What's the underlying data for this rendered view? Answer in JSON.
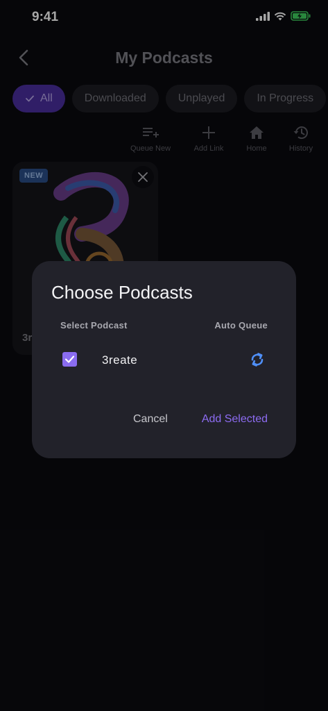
{
  "status": {
    "time": "9:41"
  },
  "nav": {
    "title": "My Podcasts"
  },
  "filters": [
    {
      "label": "All",
      "active": true
    },
    {
      "label": "Downloaded",
      "active": false
    },
    {
      "label": "Unplayed",
      "active": false
    },
    {
      "label": "In Progress",
      "active": false
    }
  ],
  "toolbar": {
    "queue_new": "Queue New",
    "add_link": "Add Link",
    "home": "Home",
    "history": "History"
  },
  "card": {
    "badge": "NEW",
    "title_partial": "3r"
  },
  "dialog": {
    "title": "Choose Podcasts",
    "col_select": "Select Podcast",
    "col_auto": "Auto Queue",
    "rows": [
      {
        "name": "3reate",
        "checked": true
      }
    ],
    "cancel": "Cancel",
    "add_selected": "Add Selected"
  },
  "colors": {
    "accent": "#8d6cf2",
    "auto_queue": "#4f8ff7"
  }
}
